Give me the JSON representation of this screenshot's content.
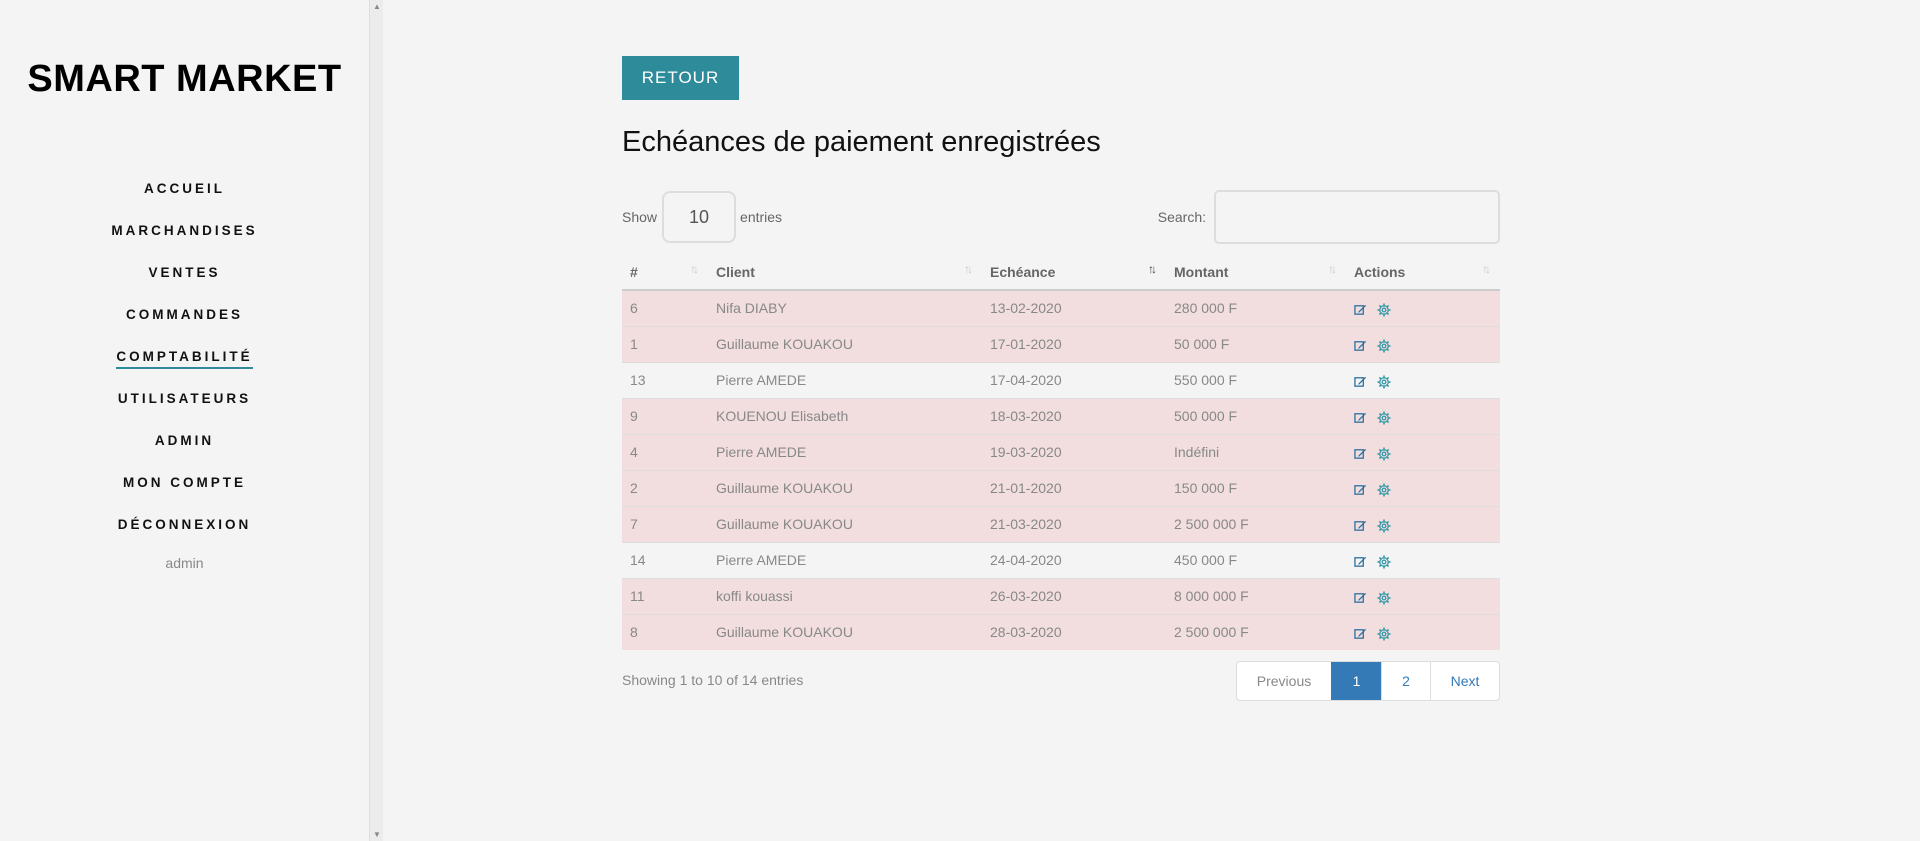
{
  "brand": "SMART MARKET",
  "nav": [
    {
      "label": "ACCUEIL",
      "active": false
    },
    {
      "label": "MARCHANDISES",
      "active": false
    },
    {
      "label": "VENTES",
      "active": false
    },
    {
      "label": "COMMANDES",
      "active": false
    },
    {
      "label": "COMPTABILITÉ",
      "active": true
    },
    {
      "label": "UTILISATEURS",
      "active": false
    },
    {
      "label": "ADMIN",
      "active": false
    },
    {
      "label": "MON COMPTE",
      "active": false
    },
    {
      "label": "DÉCONNEXION",
      "active": false
    }
  ],
  "username": "admin",
  "back_label": "RETOUR",
  "page_title": "Echéances de paiement enregistrées",
  "table_controls": {
    "show_label": "Show",
    "entries_value": "10",
    "entries_label": "entries",
    "search_label": "Search:",
    "search_value": ""
  },
  "columns": [
    "#",
    "Client",
    "Echéance",
    "Montant",
    "Actions"
  ],
  "sorted_column": "Echéance",
  "rows": [
    {
      "id": "6",
      "client": "Nifa DIABY",
      "due": "13-02-2020",
      "amount": "280 000 F",
      "late": true
    },
    {
      "id": "1",
      "client": "Guillaume KOUAKOU",
      "due": "17-01-2020",
      "amount": "50 000 F",
      "late": true
    },
    {
      "id": "13",
      "client": "Pierre AMEDE",
      "due": "17-04-2020",
      "amount": "550 000 F",
      "late": false
    },
    {
      "id": "9",
      "client": "KOUENOU Elisabeth",
      "due": "18-03-2020",
      "amount": "500 000 F",
      "late": true
    },
    {
      "id": "4",
      "client": "Pierre AMEDE",
      "due": "19-03-2020",
      "amount": "Indéfini",
      "late": true
    },
    {
      "id": "2",
      "client": "Guillaume KOUAKOU",
      "due": "21-01-2020",
      "amount": "150 000 F",
      "late": true
    },
    {
      "id": "7",
      "client": "Guillaume KOUAKOU",
      "due": "21-03-2020",
      "amount": "2 500 000 F",
      "late": true
    },
    {
      "id": "14",
      "client": "Pierre AMEDE",
      "due": "24-04-2020",
      "amount": "450 000 F",
      "late": false
    },
    {
      "id": "11",
      "client": "koffi kouassi",
      "due": "26-03-2020",
      "amount": "8 000 000 F",
      "late": true
    },
    {
      "id": "8",
      "client": "Guillaume KOUAKOU",
      "due": "28-03-2020",
      "amount": "2 500 000 F",
      "late": true
    }
  ],
  "row_icons": [
    "edit-icon",
    "settings-gear-icon"
  ],
  "info_text": "Showing 1 to 10 of 14 entries",
  "pagination": {
    "previous": "Previous",
    "pages": [
      "1",
      "2"
    ],
    "current": "1",
    "next": "Next"
  },
  "colors": {
    "accent": "#2e8b99",
    "late_row": "#f2dede",
    "page_active": "#337ab7"
  }
}
